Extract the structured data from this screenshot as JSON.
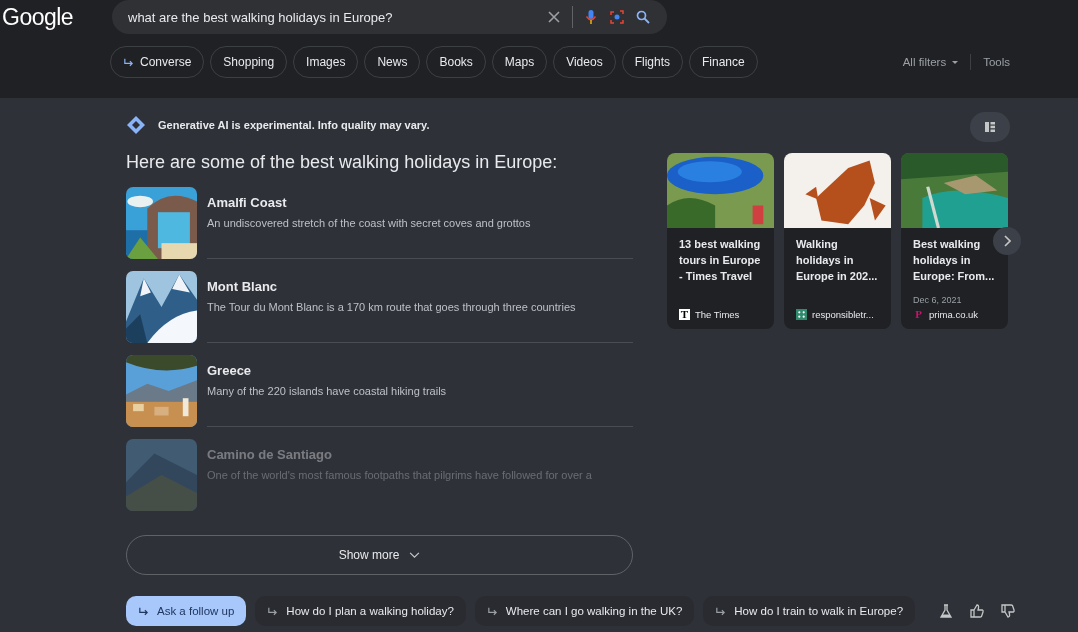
{
  "header": {
    "logo": "Google",
    "search": {
      "value": "what are the best walking holidays in Europe?"
    },
    "tabs": [
      {
        "label": "Converse",
        "selected": false,
        "kind": "converse"
      },
      {
        "label": "Shopping",
        "selected": false,
        "kind": "plain"
      },
      {
        "label": "Images",
        "selected": false,
        "kind": "plain"
      },
      {
        "label": "News",
        "selected": false,
        "kind": "plain"
      },
      {
        "label": "Books",
        "selected": false,
        "kind": "plain"
      },
      {
        "label": "Maps",
        "selected": false,
        "kind": "plain"
      },
      {
        "label": "Videos",
        "selected": false,
        "kind": "plain"
      },
      {
        "label": "Flights",
        "selected": false,
        "kind": "plain"
      },
      {
        "label": "Finance",
        "selected": false,
        "kind": "plain"
      }
    ],
    "all_filters": "All filters",
    "tools": "Tools"
  },
  "ai": {
    "notice": "Generative AI is experimental. Info quality may vary.",
    "heading": "Here are some of the best walking holidays in Europe:",
    "items": [
      {
        "title": "Amalfi Coast",
        "description": "An undiscovered stretch of the coast with secret coves and grottos",
        "faded": false
      },
      {
        "title": "Mont Blanc",
        "description": "The Tour du Mont Blanc is a 170 km route that goes through three countries",
        "faded": false
      },
      {
        "title": "Greece",
        "description": "Many of the 220 islands have coastal hiking trails",
        "faded": false
      },
      {
        "title": "Camino de Santiago",
        "description": "One of the world's most famous footpaths that pilgrims have followed for over a",
        "faded": true
      }
    ],
    "show_more": "Show more",
    "sources": [
      {
        "title": "13 best walking tours in Europe - Times Travel",
        "site": "The Times",
        "logo": "T",
        "color": "#000000"
      },
      {
        "title": "Walking holidays in Europe in 202...",
        "site": "responsibletr...",
        "color": "#2e8b6e"
      },
      {
        "title": "Best walking holidays in Europe: From...",
        "date": "Dec 6, 2021",
        "site": "prima.co.uk",
        "logo": "P",
        "color": "#d0106e"
      }
    ]
  },
  "footer": {
    "follow_ups": [
      {
        "label": "Ask a follow up",
        "selected": true
      },
      {
        "label": "How do I plan a walking holiday?",
        "selected": false
      },
      {
        "label": "Where can I go walking in the UK?",
        "selected": false
      },
      {
        "label": "How do I train to walk in Europe?",
        "selected": false
      }
    ]
  }
}
